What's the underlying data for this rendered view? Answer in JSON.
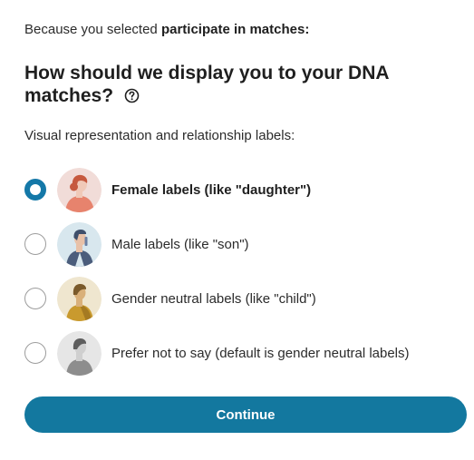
{
  "intro": {
    "prefix": "Because you selected ",
    "selection": "participate in matches:"
  },
  "headline": "How should we display you to your DNA matches?",
  "help_icon": "question-circle-icon",
  "subtitle": "Visual representation and relationship labels:",
  "options": [
    {
      "label": "Female labels (like \"daughter\")",
      "selected": true,
      "avatar": "female-avatar-icon"
    },
    {
      "label": "Male labels (like \"son\")",
      "selected": false,
      "avatar": "male-avatar-icon"
    },
    {
      "label": "Gender neutral labels (like \"child\")",
      "selected": false,
      "avatar": "gender-neutral-avatar-icon"
    },
    {
      "label": "Prefer not to say (default is gender neutral labels)",
      "selected": false,
      "avatar": "unspecified-avatar-icon"
    }
  ],
  "continue_label": "Continue",
  "colors": {
    "accent": "#13789f",
    "radio_selected": "#1478a8",
    "text": "#222222"
  }
}
